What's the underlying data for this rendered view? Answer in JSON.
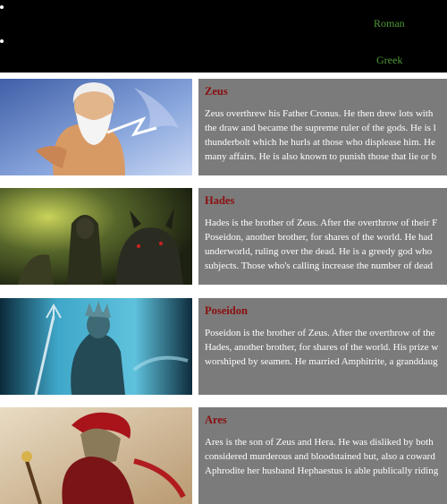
{
  "nav": {
    "roman_label": "Roman",
    "greek_label": "Greek"
  },
  "colors": {
    "nav_link": "#4e9a36",
    "title": "#8b0f0f",
    "panel": "#7b7b7b",
    "header": "#000000"
  },
  "gods": [
    {
      "name": "Zeus",
      "image_icon": "zeus-portrait",
      "lines": [
        "Zeus overthrew his Father Cronus. He then drew lots with",
        "the draw and became the supreme ruler of the gods. He is l",
        "thunderbolt which he hurls at those who displease him. He",
        "many affairs. He is also known to punish those that lie or b"
      ]
    },
    {
      "name": "Hades",
      "image_icon": "hades-portrait",
      "lines": [
        "Hades is the brother of Zeus. After the overthrow of their F",
        "Poseidon, another brother, for shares of the world. He had",
        "underworld, ruling over the dead. He is a greedy god who",
        "subjects. Those who's calling increase the number of dead"
      ]
    },
    {
      "name": "Poseidon",
      "image_icon": "poseidon-portrait",
      "lines": [
        "Poseidon is the brother of Zeus. After the overthrow of the",
        "Hades, another brother, for shares of the world. His prize w",
        "worshiped by seamen. He married Amphitrite, a granddaug"
      ]
    },
    {
      "name": "Ares",
      "image_icon": "ares-portrait",
      "lines": [
        "Ares is the son of Zeus and Hera. He was disliked by both",
        "considered murderous and bloodstained but, also a coward",
        "Aphrodite her husband Hephaestus is able publically riding"
      ]
    }
  ]
}
